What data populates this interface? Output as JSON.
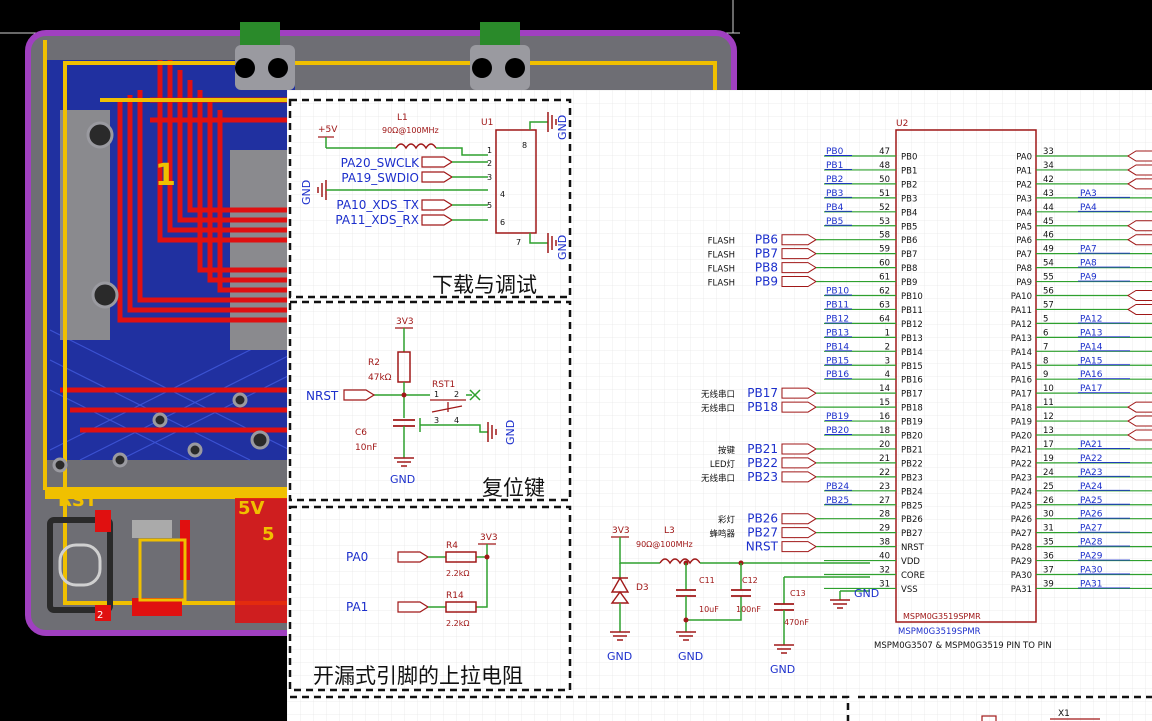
{
  "pcb": {
    "silk_rst": "RST",
    "silk_5v": "5V",
    "silk_5v2": "5",
    "silk_1": "1",
    "silk_2": "2"
  },
  "debug": {
    "title": "下载与调试",
    "inductor_ref": "L1",
    "inductor_val": "90Ω@100MHz",
    "power": "+5V",
    "conn_ref": "U1",
    "gnd": "GND",
    "pin_nums": [
      "1",
      "2",
      "3",
      "4",
      "5",
      "6"
    ],
    "pin_8": "8",
    "pin_7": "7",
    "net_swclk": "PA20_SWCLK",
    "net_swdio": "PA19_SWDIO",
    "net_tx": "PA10_XDS_TX",
    "net_rx": "PA11_XDS_RX"
  },
  "reset": {
    "title": "复位键",
    "vcc": "3V3",
    "r_ref": "R2",
    "r_val": "47kΩ",
    "sw_ref": "RST1",
    "sw_pins": [
      "1",
      "2",
      "3",
      "4"
    ],
    "c_ref": "C6",
    "c_val": "10nF",
    "net": "NRST",
    "gnd": "GND",
    "gnd2": "GND"
  },
  "pullup": {
    "title": "开漏式引脚的上拉电阻",
    "vcc": "3V3",
    "r4_ref": "R4",
    "r4_val": "2.2kΩ",
    "r14_ref": "R14",
    "r14_val": "2.2kΩ",
    "net_pa0": "PA0",
    "net_pa1": "PA1"
  },
  "power": {
    "vcc": "3V3",
    "l_ref": "L3",
    "l_val": "90Ω@100MHz",
    "d_ref": "D3",
    "c11_ref": "C11",
    "c11_val": "10uF",
    "c12_ref": "C12",
    "c12_val": "100nF",
    "c13_ref": "C13",
    "c13_val": "470nF",
    "gnd": "GND"
  },
  "mcu": {
    "ref": "U2",
    "part1": "MSPM0G3519SPMR",
    "part2": "MSPM0G3519SPMR",
    "note": "MSPM0G3507 & MSPM0G3519 PIN TO PIN",
    "gnd": "GND",
    "x1": "X1",
    "left_pins": [
      {
        "name": "PB0",
        "num": "47",
        "net": "PB0"
      },
      {
        "name": "PB1",
        "num": "48",
        "net": "PB1"
      },
      {
        "name": "PB2",
        "num": "50",
        "net": "PB2"
      },
      {
        "name": "PB3",
        "num": "51",
        "net": "PB3"
      },
      {
        "name": "PB4",
        "num": "52",
        "net": "PB4"
      },
      {
        "name": "PB5",
        "num": "53",
        "net": "PB5"
      },
      {
        "name": "PB6",
        "num": "58",
        "net": "PB6",
        "flag": "PB6",
        "desc": "FLASH"
      },
      {
        "name": "PB7",
        "num": "59",
        "net": "PB7",
        "flag": "PB7",
        "desc": "FLASH"
      },
      {
        "name": "PB8",
        "num": "60",
        "net": "PB8",
        "flag": "PB8",
        "desc": "FLASH"
      },
      {
        "name": "PB9",
        "num": "61",
        "net": "PB9",
        "flag": "PB9",
        "desc": "FLASH"
      },
      {
        "name": "PB10",
        "num": "62",
        "net": "PB10"
      },
      {
        "name": "PB11",
        "num": "63",
        "net": "PB11"
      },
      {
        "name": "PB12",
        "num": "64",
        "net": "PB12"
      },
      {
        "name": "PB13",
        "num": "1",
        "net": "PB13"
      },
      {
        "name": "PB14",
        "num": "2",
        "net": "PB14"
      },
      {
        "name": "PB15",
        "num": "3",
        "net": "PB15"
      },
      {
        "name": "PB16",
        "num": "4",
        "net": "PB16"
      },
      {
        "name": "PB17",
        "num": "14",
        "net": "PB17",
        "flag": "PB17",
        "desc": "无线串口"
      },
      {
        "name": "PB18",
        "num": "15",
        "net": "PB18",
        "flag": "PB18",
        "desc": "无线串口"
      },
      {
        "name": "PB19",
        "num": "16",
        "net": "PB19"
      },
      {
        "name": "PB20",
        "num": "18",
        "net": "PB20"
      },
      {
        "name": "PB21",
        "num": "20",
        "net": "PB21",
        "flag": "PB21",
        "desc": "按键"
      },
      {
        "name": "PB22",
        "num": "21",
        "net": "PB22",
        "flag": "PB22",
        "desc": "LED灯"
      },
      {
        "name": "PB23",
        "num": "22",
        "net": "PB23",
        "flag": "PB23",
        "desc": "无线串口"
      },
      {
        "name": "PB24",
        "num": "23",
        "net": "PB24"
      },
      {
        "name": "PB25",
        "num": "27",
        "net": "PB25"
      },
      {
        "name": "PB26",
        "num": "28",
        "net": "PB26",
        "flag": "PB26",
        "desc": "彩灯"
      },
      {
        "name": "PB27",
        "num": "29",
        "net": "PB27",
        "flag": "PB27",
        "desc": "蜂鸣器"
      },
      {
        "name": "NRST",
        "num": "38",
        "net": "NRST",
        "flag": "NRST"
      },
      {
        "name": "VDD",
        "num": "40",
        "net": ""
      },
      {
        "name": "CORE",
        "num": "32",
        "net": ""
      },
      {
        "name": "VSS",
        "num": "31",
        "net": ""
      }
    ],
    "right_pins": [
      {
        "name": "PA0",
        "num": "33",
        "net": ""
      },
      {
        "name": "PA1",
        "num": "34",
        "net": ""
      },
      {
        "name": "PA2",
        "num": "42",
        "net": ""
      },
      {
        "name": "PA3",
        "num": "43",
        "net": "PA3"
      },
      {
        "name": "PA4",
        "num": "44",
        "net": "PA4"
      },
      {
        "name": "PA5",
        "num": "45",
        "net": ""
      },
      {
        "name": "PA6",
        "num": "46",
        "net": ""
      },
      {
        "name": "PA7",
        "num": "49",
        "net": "PA7"
      },
      {
        "name": "PA8",
        "num": "54",
        "net": "PA8"
      },
      {
        "name": "PA9",
        "num": "55",
        "net": "PA9"
      },
      {
        "name": "PA10",
        "num": "56",
        "net": ""
      },
      {
        "name": "PA11",
        "num": "57",
        "net": ""
      },
      {
        "name": "PA12",
        "num": "5",
        "net": "PA12"
      },
      {
        "name": "PA13",
        "num": "6",
        "net": "PA13"
      },
      {
        "name": "PA14",
        "num": "7",
        "net": "PA14"
      },
      {
        "name": "PA15",
        "num": "8",
        "net": "PA15"
      },
      {
        "name": "PA16",
        "num": "9",
        "net": "PA16"
      },
      {
        "name": "PA17",
        "num": "10",
        "net": "PA17"
      },
      {
        "name": "PA18",
        "num": "11",
        "net": ""
      },
      {
        "name": "PA19",
        "num": "12",
        "net": ""
      },
      {
        "name": "PA20",
        "num": "13",
        "net": ""
      },
      {
        "name": "PA21",
        "num": "17",
        "net": "PA21"
      },
      {
        "name": "PA22",
        "num": "19",
        "net": "PA22"
      },
      {
        "name": "PA23",
        "num": "24",
        "net": "PA23"
      },
      {
        "name": "PA24",
        "num": "25",
        "net": "PA24"
      },
      {
        "name": "PA25",
        "num": "26",
        "net": "PA25"
      },
      {
        "name": "PA26",
        "num": "30",
        "net": "PA26"
      },
      {
        "name": "PA27",
        "num": "31",
        "net": "PA27"
      },
      {
        "name": "PA28",
        "num": "35",
        "net": "PA28"
      },
      {
        "name": "PA29",
        "num": "36",
        "net": "PA29"
      },
      {
        "name": "PA30",
        "num": "37",
        "net": "PA30"
      },
      {
        "name": "PA31",
        "num": "39",
        "net": "PA31"
      }
    ]
  },
  "colors": {
    "schematic_bg": "#ffffff",
    "wire": "#2ea02e",
    "component": "#a01818",
    "net_label": "#1c2fcc",
    "pcb_track": "#e01010",
    "pcb_silk": "#f0c000",
    "pcb_bottom": "#2030a0",
    "pcb_outline": "#a040c0"
  }
}
